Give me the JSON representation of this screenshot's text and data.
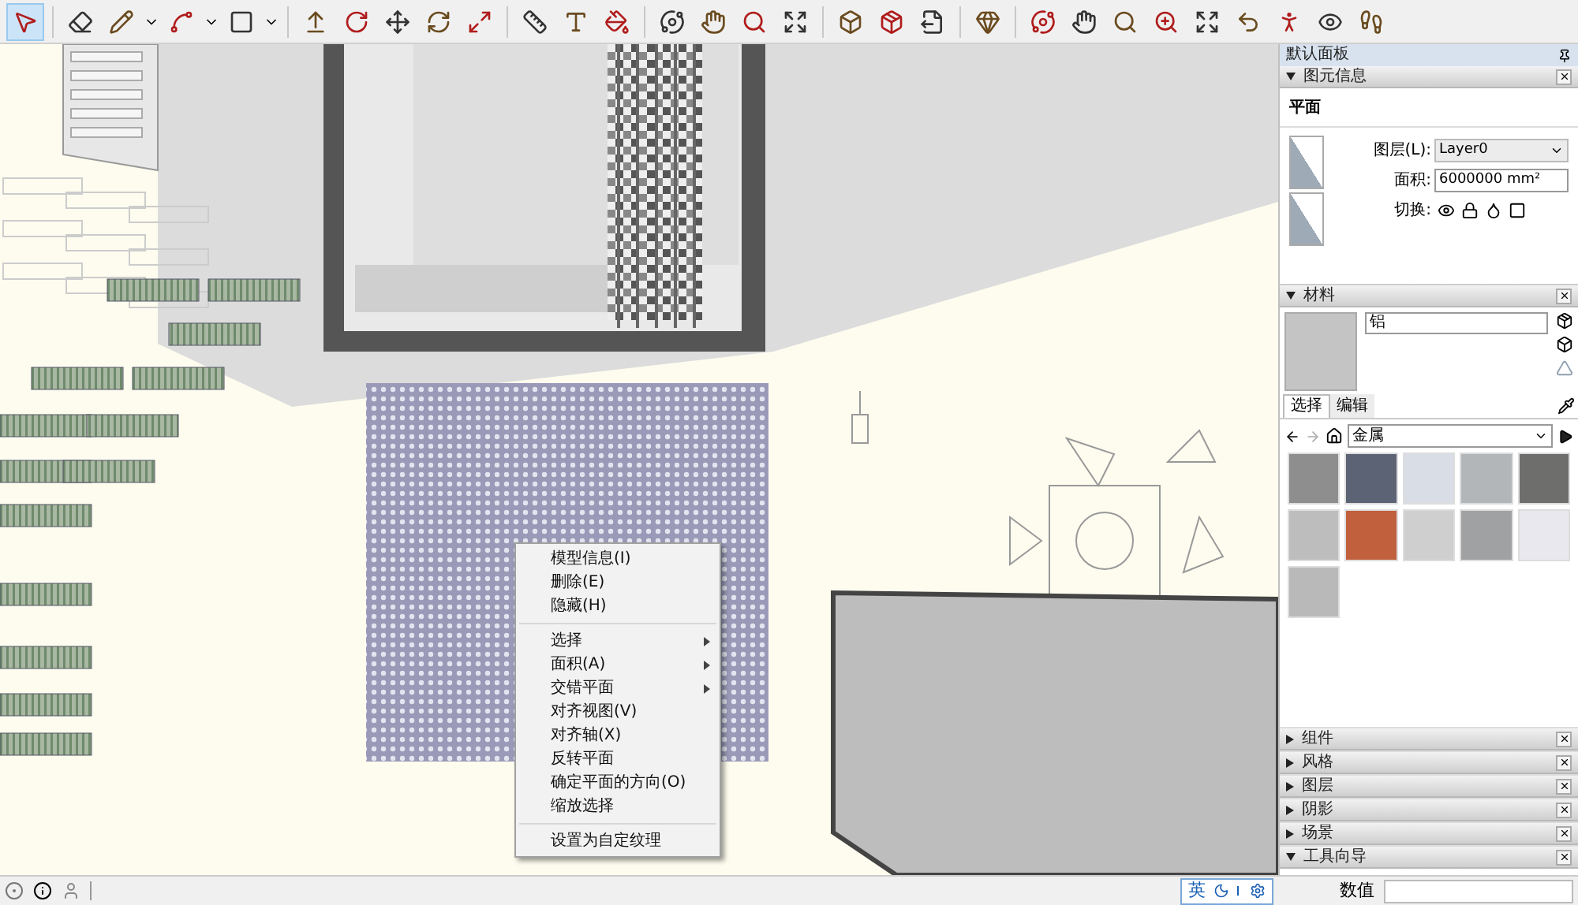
{
  "toolbar": {
    "tools": [
      {
        "selected": true
      },
      {
        "selected": false
      },
      {
        "selected": false
      },
      {
        "selected": false
      },
      {
        "selected": false
      },
      {
        "selected": false
      },
      {
        "selected": false
      },
      {
        "selected": false
      },
      {
        "selected": false
      },
      {
        "selected": false
      },
      {
        "selected": false
      },
      {
        "selected": false
      },
      {
        "selected": false
      },
      {
        "selected": false
      },
      {
        "selected": false
      },
      {
        "selected": false
      },
      {
        "selected": false
      },
      {
        "selected": false
      },
      {
        "selected": false
      },
      {
        "selected": false
      },
      {
        "selected": false
      },
      {
        "selected": false
      },
      {
        "selected": false
      },
      {
        "selected": false
      },
      {
        "selected": false
      },
      {
        "selected": false
      },
      {
        "selected": false
      },
      {
        "selected": false
      },
      {
        "selected": false
      },
      {
        "selected": false
      }
    ]
  },
  "context_menu": {
    "items": [
      {
        "kind": "item",
        "label": "模型信息(I)",
        "submenu": false
      },
      {
        "kind": "item",
        "label": "删除(E)",
        "submenu": false
      },
      {
        "kind": "item",
        "label": "隐藏(H)",
        "submenu": false
      },
      {
        "kind": "separator"
      },
      {
        "kind": "item",
        "label": "选择",
        "submenu": true
      },
      {
        "kind": "item",
        "label": "面积(A)",
        "submenu": true
      },
      {
        "kind": "item",
        "label": "交错平面",
        "submenu": true
      },
      {
        "kind": "item",
        "label": "对齐视图(V)",
        "submenu": false
      },
      {
        "kind": "item",
        "label": "对齐轴(X)",
        "submenu": false
      },
      {
        "kind": "item",
        "label": "反转平面",
        "submenu": false
      },
      {
        "kind": "item",
        "label": "确定平面的方向(O)",
        "submenu": false
      },
      {
        "kind": "item",
        "label": "缩放选择",
        "submenu": false
      },
      {
        "kind": "separator"
      },
      {
        "kind": "item",
        "label": "设置为自定纹理",
        "submenu": false
      }
    ]
  },
  "tray": {
    "title": "默认面板",
    "entity_info": {
      "title": "图元信息",
      "expanded": true,
      "entity_type": "平面",
      "layer_label": "图层(L):",
      "layer_value": "Layer0",
      "area_label": "面积:",
      "area_value": "6000000 mm²",
      "toggle_label": "切换:"
    },
    "materials": {
      "title": "材料",
      "expanded": true,
      "name": "铝",
      "tabs": [
        {
          "label": "选择",
          "selected": true
        },
        {
          "label": "编辑",
          "selected": false
        }
      ],
      "collection": "金属",
      "swatches": [
        {
          "color": "#8e8e8e"
        },
        {
          "color": "#5b6375"
        },
        {
          "color": "#d9dde6"
        },
        {
          "color": "#b3b6b8"
        },
        {
          "color": "#6e6f6c"
        },
        {
          "color": "#bdbdbd"
        },
        {
          "color": "#c0603c"
        },
        {
          "color": "#cfcfcf"
        },
        {
          "color": "#9fa1a2"
        },
        {
          "color": "#e8e8ee"
        },
        {
          "color": "#b9b9b9"
        }
      ]
    },
    "collapsed_panels": [
      {
        "title": "组件",
        "expanded": false
      },
      {
        "title": "风格",
        "expanded": false
      },
      {
        "title": "图层",
        "expanded": false
      },
      {
        "title": "阴影",
        "expanded": false
      },
      {
        "title": "场景",
        "expanded": false
      },
      {
        "title": "工具向导",
        "expanded": true
      }
    ]
  },
  "status_bar": {
    "ime": "英",
    "measurements_label": "数值"
  }
}
